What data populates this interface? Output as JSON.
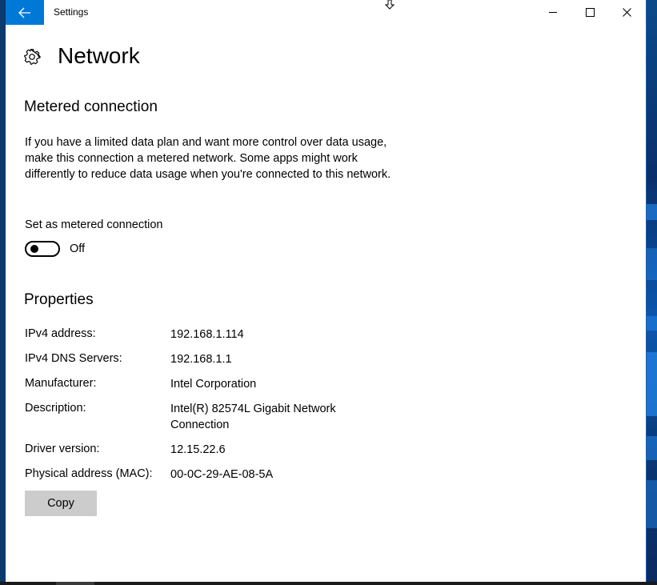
{
  "window": {
    "title": "Settings"
  },
  "header": {
    "title": "Network"
  },
  "metered": {
    "heading": "Metered connection",
    "description": "If you have a limited data plan and want more control over data usage, make this connection a metered network. Some apps might work differently to reduce data usage when you're connected to this network.",
    "toggle_label": "Set as metered connection",
    "toggle_state": "Off"
  },
  "properties": {
    "heading": "Properties",
    "rows": [
      {
        "label": "IPv4 address:",
        "value": "192.168.1.114"
      },
      {
        "label": "IPv4 DNS Servers:",
        "value": "192.168.1.1"
      },
      {
        "label": "Manufacturer:",
        "value": "Intel Corporation"
      },
      {
        "label": "Description:",
        "value": "Intel(R) 82574L Gigabit Network Connection"
      },
      {
        "label": "Driver version:",
        "value": "12.15.22.6"
      },
      {
        "label": "Physical address (MAC):",
        "value": "00-0C-29-AE-08-5A"
      }
    ],
    "copy_label": "Copy"
  },
  "colors": {
    "accent": "#0078d7",
    "button_bg": "#cccccc"
  },
  "icons": {
    "back": "back-arrow-icon",
    "settings": "gear-icon",
    "minimize": "minimize-icon",
    "maximize": "maximize-icon",
    "close": "close-icon"
  }
}
